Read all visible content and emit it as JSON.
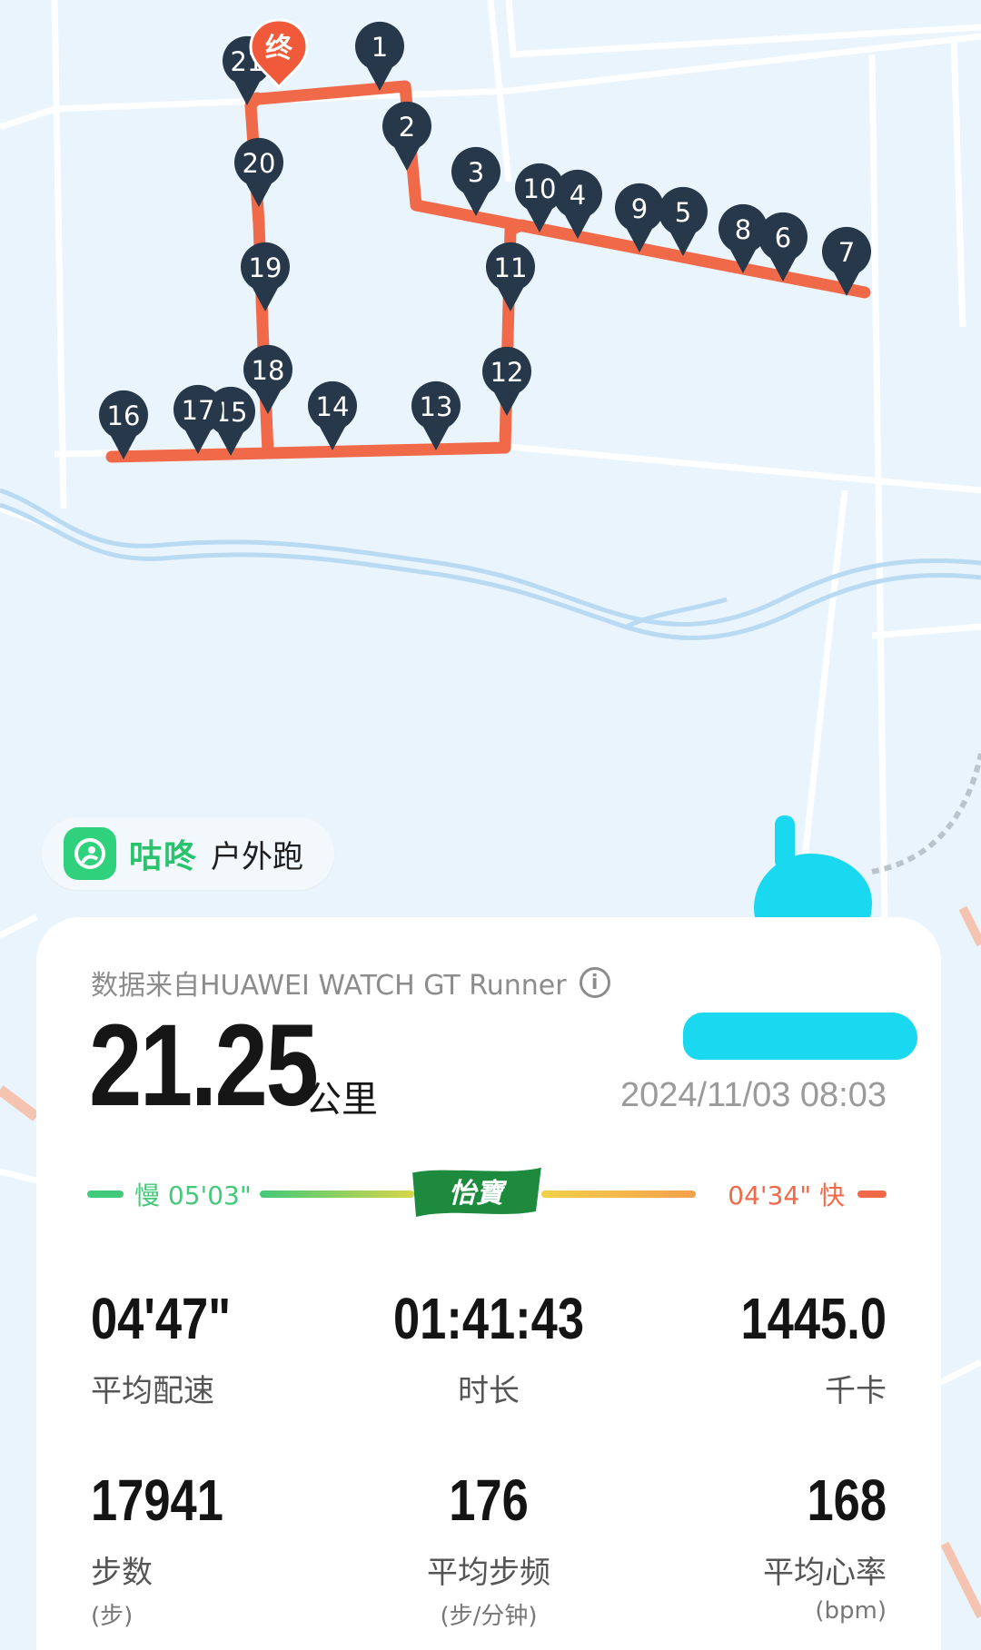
{
  "route": {
    "markers": [
      "1",
      "2",
      "3",
      "4",
      "5",
      "6",
      "7",
      "8",
      "9",
      "10",
      "11",
      "12",
      "13",
      "14",
      "15",
      "16",
      "17",
      "18",
      "19",
      "20",
      "21"
    ],
    "end_label": "终"
  },
  "app": {
    "name": "咕咚",
    "sport": "户外跑"
  },
  "summary": {
    "source": "数据来自HUAWEI WATCH GT Runner",
    "distance": "21.25",
    "distance_unit": "公里",
    "datetime": "2024/11/03 08:03"
  },
  "pace_range": {
    "slow_label": "慢 05'03\"",
    "fast_label": "04'34\" 快",
    "sponsor_logo": "怡寶"
  },
  "stats": [
    {
      "value": "04'47\"",
      "label": "平均配速",
      "sub": ""
    },
    {
      "value": "01:41:43",
      "label": "时长",
      "sub": ""
    },
    {
      "value": "1445.0",
      "label": "千卡",
      "sub": ""
    },
    {
      "value": "17941",
      "label": "步数",
      "sub": "(步)"
    },
    {
      "value": "176",
      "label": "平均步频",
      "sub": "(步/分钟)"
    },
    {
      "value": "168",
      "label": "平均心率",
      "sub": "(bpm)"
    }
  ],
  "colors": {
    "route": "#f06a4a",
    "marker": "#26384a",
    "brand_green": "#29c36d",
    "river": "#b8daf2"
  }
}
